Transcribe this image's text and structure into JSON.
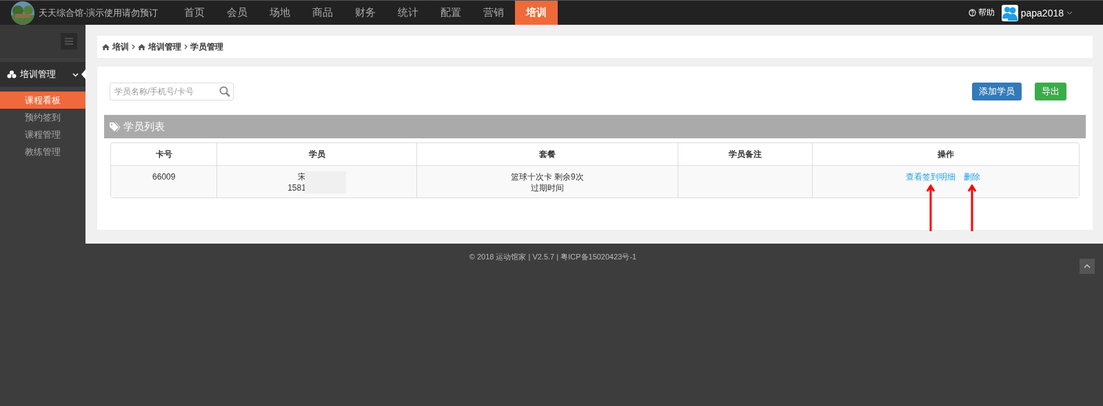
{
  "header": {
    "site_title": "天天综合馆-演示使用请勿预订",
    "help": "帮助",
    "user": "papa2018",
    "nav": [
      {
        "label": "首页",
        "selected": false
      },
      {
        "label": "会员",
        "selected": false
      },
      {
        "label": "场地",
        "selected": false
      },
      {
        "label": "商品",
        "selected": false
      },
      {
        "label": "财务",
        "selected": false
      },
      {
        "label": "统计",
        "selected": false
      },
      {
        "label": "配置",
        "selected": false
      },
      {
        "label": "营销",
        "selected": false
      },
      {
        "label": "培训",
        "selected": true
      }
    ]
  },
  "sidebar": {
    "group": {
      "label": "培训管理",
      "expanded": true,
      "items": [
        {
          "label": "课程看板",
          "selected": true
        },
        {
          "label": "预约签到",
          "selected": false
        },
        {
          "label": "课程管理",
          "selected": false
        },
        {
          "label": "教练管理",
          "selected": false
        }
      ]
    }
  },
  "breadcrumb": [
    {
      "label": "培训",
      "icon": true
    },
    {
      "label": "培训管理",
      "icon": true
    },
    {
      "label": "学员管理",
      "icon": false
    }
  ],
  "search": {
    "placeholder": "学员名称/手机号/卡号"
  },
  "buttons": [
    {
      "label": "添加学员",
      "kind": "primary"
    },
    {
      "label": "导出",
      "kind": "success"
    }
  ],
  "panel_title": "学员列表",
  "table": {
    "columns": [
      "卡号",
      "学员",
      "套餐",
      "学员备注",
      "操作"
    ],
    "rows": [
      {
        "card": "66009",
        "student": [
          "宋",
          "1581"
        ],
        "redacted": true,
        "package": [
          "篮球十次卡 剩余9次",
          "过期时间"
        ],
        "note": "",
        "actions": [
          {
            "label": "查看签到明细",
            "marked": true
          },
          {
            "label": "删除",
            "marked": true
          }
        ]
      }
    ]
  },
  "footer": "© 2018 运动馆家 | V2.5.7 | 粤ICP备15020423号-1"
}
